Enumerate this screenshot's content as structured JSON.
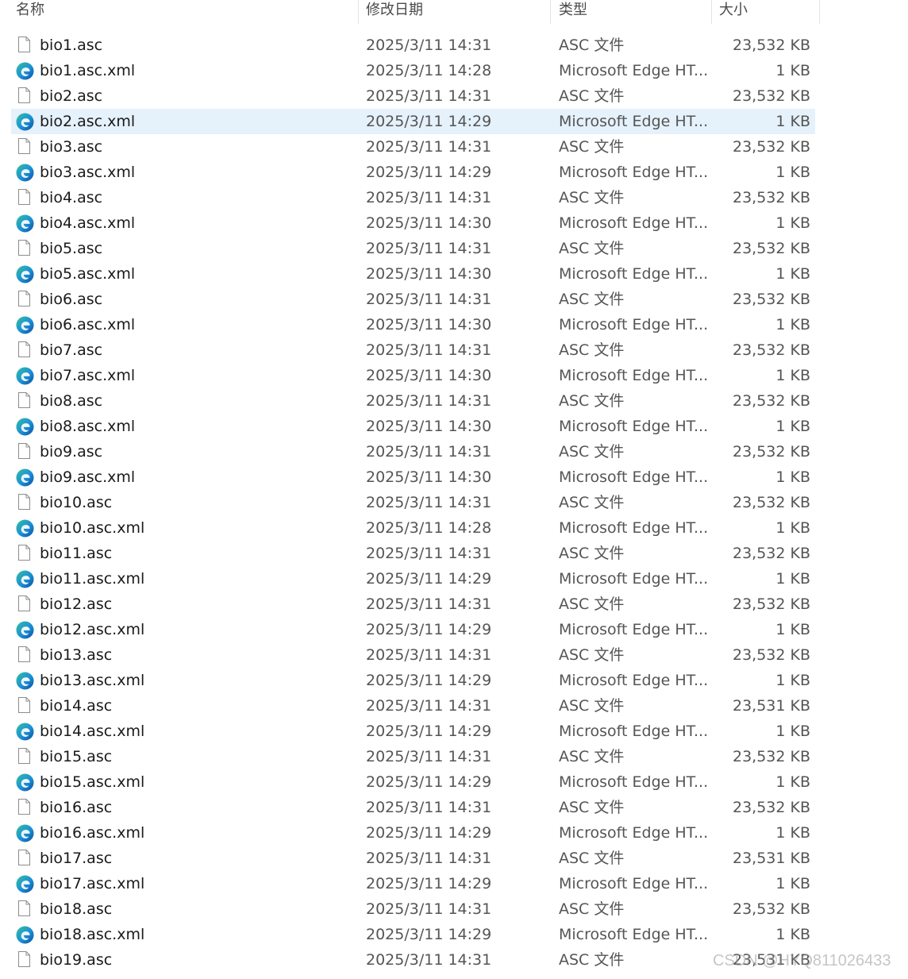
{
  "columns": {
    "name": "名称",
    "date": "修改日期",
    "type": "类型",
    "size": "大小"
  },
  "selected_row": 3,
  "files": [
    {
      "name": "bio1.asc",
      "date": "2025/3/11 14:31",
      "type": "ASC 文件",
      "size": "23,532 KB",
      "icon": "file-icon"
    },
    {
      "name": "bio1.asc.xml",
      "date": "2025/3/11 14:28",
      "type": "Microsoft Edge HT...",
      "size": "1 KB",
      "icon": "edge-icon"
    },
    {
      "name": "bio2.asc",
      "date": "2025/3/11 14:31",
      "type": "ASC 文件",
      "size": "23,532 KB",
      "icon": "file-icon"
    },
    {
      "name": "bio2.asc.xml",
      "date": "2025/3/11 14:29",
      "type": "Microsoft Edge HT...",
      "size": "1 KB",
      "icon": "edge-icon"
    },
    {
      "name": "bio3.asc",
      "date": "2025/3/11 14:31",
      "type": "ASC 文件",
      "size": "23,532 KB",
      "icon": "file-icon"
    },
    {
      "name": "bio3.asc.xml",
      "date": "2025/3/11 14:29",
      "type": "Microsoft Edge HT...",
      "size": "1 KB",
      "icon": "edge-icon"
    },
    {
      "name": "bio4.asc",
      "date": "2025/3/11 14:31",
      "type": "ASC 文件",
      "size": "23,532 KB",
      "icon": "file-icon"
    },
    {
      "name": "bio4.asc.xml",
      "date": "2025/3/11 14:30",
      "type": "Microsoft Edge HT...",
      "size": "1 KB",
      "icon": "edge-icon"
    },
    {
      "name": "bio5.asc",
      "date": "2025/3/11 14:31",
      "type": "ASC 文件",
      "size": "23,532 KB",
      "icon": "file-icon"
    },
    {
      "name": "bio5.asc.xml",
      "date": "2025/3/11 14:30",
      "type": "Microsoft Edge HT...",
      "size": "1 KB",
      "icon": "edge-icon"
    },
    {
      "name": "bio6.asc",
      "date": "2025/3/11 14:31",
      "type": "ASC 文件",
      "size": "23,532 KB",
      "icon": "file-icon"
    },
    {
      "name": "bio6.asc.xml",
      "date": "2025/3/11 14:30",
      "type": "Microsoft Edge HT...",
      "size": "1 KB",
      "icon": "edge-icon"
    },
    {
      "name": "bio7.asc",
      "date": "2025/3/11 14:31",
      "type": "ASC 文件",
      "size": "23,532 KB",
      "icon": "file-icon"
    },
    {
      "name": "bio7.asc.xml",
      "date": "2025/3/11 14:30",
      "type": "Microsoft Edge HT...",
      "size": "1 KB",
      "icon": "edge-icon"
    },
    {
      "name": "bio8.asc",
      "date": "2025/3/11 14:31",
      "type": "ASC 文件",
      "size": "23,532 KB",
      "icon": "file-icon"
    },
    {
      "name": "bio8.asc.xml",
      "date": "2025/3/11 14:30",
      "type": "Microsoft Edge HT...",
      "size": "1 KB",
      "icon": "edge-icon"
    },
    {
      "name": "bio9.asc",
      "date": "2025/3/11 14:31",
      "type": "ASC 文件",
      "size": "23,532 KB",
      "icon": "file-icon"
    },
    {
      "name": "bio9.asc.xml",
      "date": "2025/3/11 14:30",
      "type": "Microsoft Edge HT...",
      "size": "1 KB",
      "icon": "edge-icon"
    },
    {
      "name": "bio10.asc",
      "date": "2025/3/11 14:31",
      "type": "ASC 文件",
      "size": "23,532 KB",
      "icon": "file-icon"
    },
    {
      "name": "bio10.asc.xml",
      "date": "2025/3/11 14:28",
      "type": "Microsoft Edge HT...",
      "size": "1 KB",
      "icon": "edge-icon"
    },
    {
      "name": "bio11.asc",
      "date": "2025/3/11 14:31",
      "type": "ASC 文件",
      "size": "23,532 KB",
      "icon": "file-icon"
    },
    {
      "name": "bio11.asc.xml",
      "date": "2025/3/11 14:29",
      "type": "Microsoft Edge HT...",
      "size": "1 KB",
      "icon": "edge-icon"
    },
    {
      "name": "bio12.asc",
      "date": "2025/3/11 14:31",
      "type": "ASC 文件",
      "size": "23,532 KB",
      "icon": "file-icon"
    },
    {
      "name": "bio12.asc.xml",
      "date": "2025/3/11 14:29",
      "type": "Microsoft Edge HT...",
      "size": "1 KB",
      "icon": "edge-icon"
    },
    {
      "name": "bio13.asc",
      "date": "2025/3/11 14:31",
      "type": "ASC 文件",
      "size": "23,532 KB",
      "icon": "file-icon"
    },
    {
      "name": "bio13.asc.xml",
      "date": "2025/3/11 14:29",
      "type": "Microsoft Edge HT...",
      "size": "1 KB",
      "icon": "edge-icon"
    },
    {
      "name": "bio14.asc",
      "date": "2025/3/11 14:31",
      "type": "ASC 文件",
      "size": "23,531 KB",
      "icon": "file-icon"
    },
    {
      "name": "bio14.asc.xml",
      "date": "2025/3/11 14:29",
      "type": "Microsoft Edge HT...",
      "size": "1 KB",
      "icon": "edge-icon"
    },
    {
      "name": "bio15.asc",
      "date": "2025/3/11 14:31",
      "type": "ASC 文件",
      "size": "23,532 KB",
      "icon": "file-icon"
    },
    {
      "name": "bio15.asc.xml",
      "date": "2025/3/11 14:29",
      "type": "Microsoft Edge HT...",
      "size": "1 KB",
      "icon": "edge-icon"
    },
    {
      "name": "bio16.asc",
      "date": "2025/3/11 14:31",
      "type": "ASC 文件",
      "size": "23,532 KB",
      "icon": "file-icon"
    },
    {
      "name": "bio16.asc.xml",
      "date": "2025/3/11 14:29",
      "type": "Microsoft Edge HT...",
      "size": "1 KB",
      "icon": "edge-icon"
    },
    {
      "name": "bio17.asc",
      "date": "2025/3/11 14:31",
      "type": "ASC 文件",
      "size": "23,531 KB",
      "icon": "file-icon"
    },
    {
      "name": "bio17.asc.xml",
      "date": "2025/3/11 14:29",
      "type": "Microsoft Edge HT...",
      "size": "1 KB",
      "icon": "edge-icon"
    },
    {
      "name": "bio18.asc",
      "date": "2025/3/11 14:31",
      "type": "ASC 文件",
      "size": "23,532 KB",
      "icon": "file-icon"
    },
    {
      "name": "bio18.asc.xml",
      "date": "2025/3/11 14:29",
      "type": "Microsoft Edge HT...",
      "size": "1 KB",
      "icon": "edge-icon"
    },
    {
      "name": "bio19.asc",
      "date": "2025/3/11 14:31",
      "type": "ASC 文件",
      "size": "23,531 KB",
      "icon": "file-icon"
    }
  ],
  "watermark": "CSDN @HYQ811026433",
  "colors": {
    "selected_bg": "#e5f1fb",
    "edge_blue": "#0c59a4",
    "edge_green": "#35c1a0"
  }
}
